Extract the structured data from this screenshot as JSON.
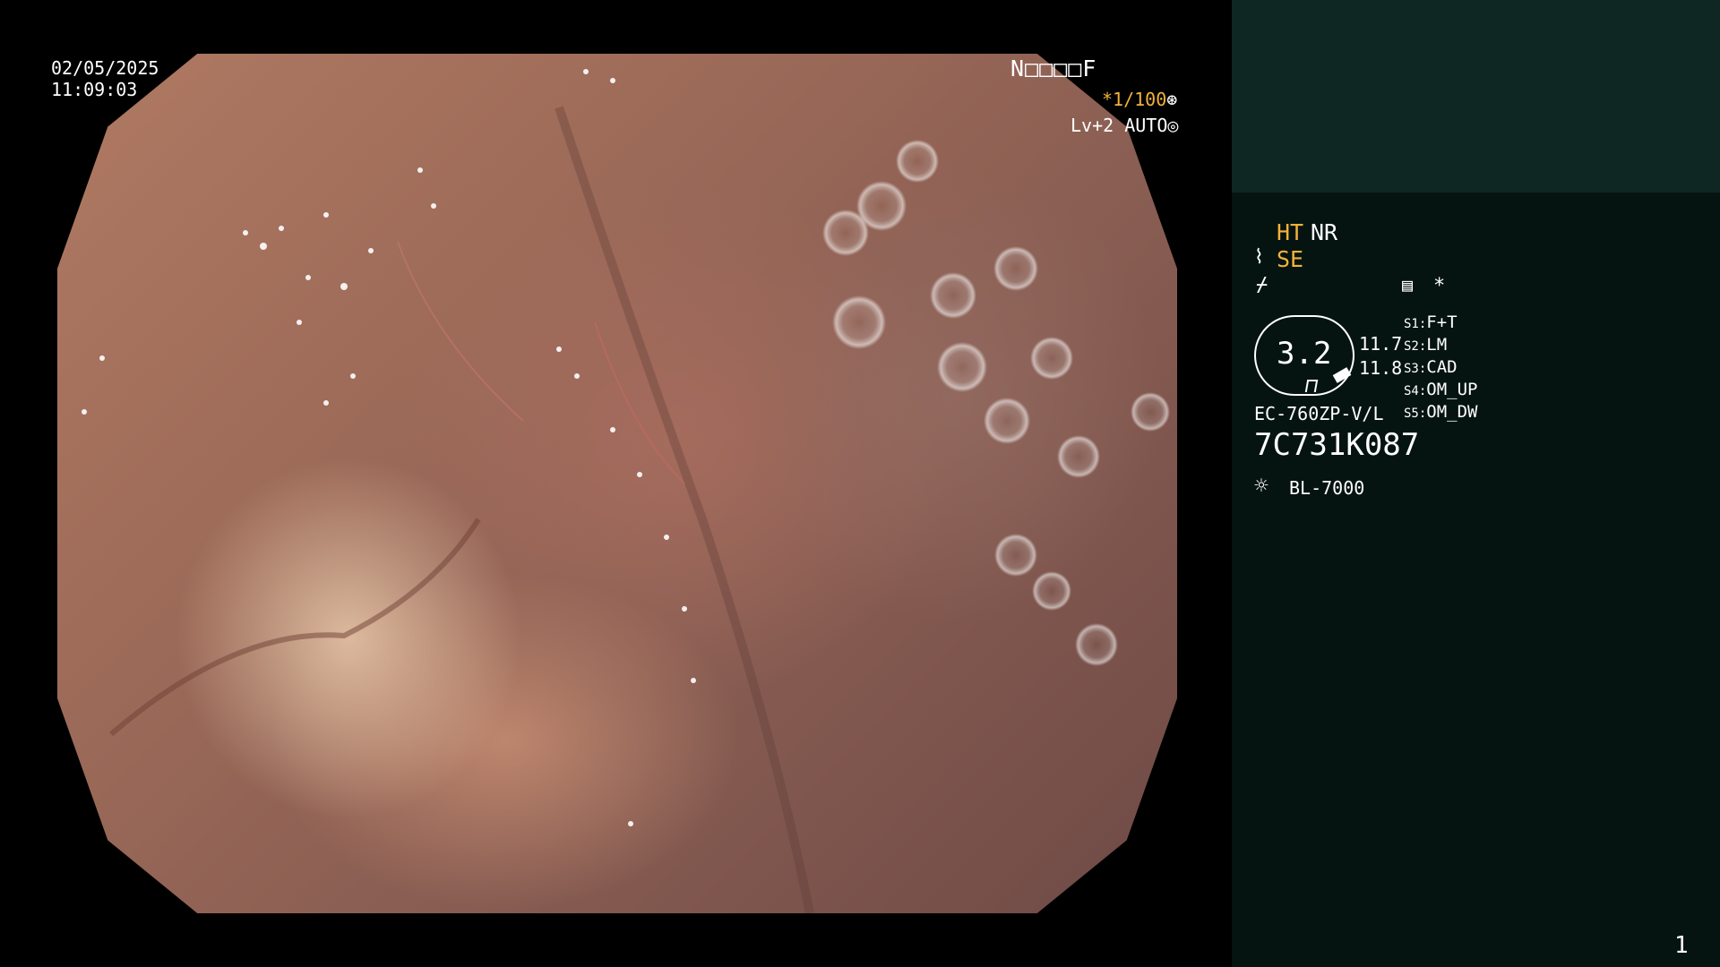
{
  "overlay": {
    "date": "02/05/2025",
    "time": "11:09:03",
    "patient_id": "N□□□□F",
    "shutter_prefix": "*",
    "shutter": "1/100",
    "shutter_icon": "⊛",
    "level": "Lv+2 AUTO",
    "level_icon": "◎"
  },
  "panel": {
    "ht": "HT",
    "nr": "NR",
    "se_icon": "⌇",
    "se": "SE",
    "enhance_icon": "⌿",
    "doc_icon": "▤",
    "star": "*",
    "zoom_value": "3.2",
    "value_1": "11.7",
    "value_2": "11.8",
    "switches": [
      {
        "key": "S1:",
        "value": "F+T"
      },
      {
        "key": "S2:",
        "value": "LM"
      },
      {
        "key": "S3:",
        "value": "CAD"
      },
      {
        "key": "S4:",
        "value": "OM_UP"
      },
      {
        "key": "S5:",
        "value": "OM_DW"
      }
    ],
    "scope_model": "EC-760ZP-V/L",
    "serial": "7C731K087",
    "light_icon": "☼",
    "light_source": "BL-7000",
    "page_number": "1"
  },
  "colors": {
    "accent_orange": "#f2b23a",
    "panel_bg": "#061411",
    "panel_top_bg": "#0f2723"
  }
}
